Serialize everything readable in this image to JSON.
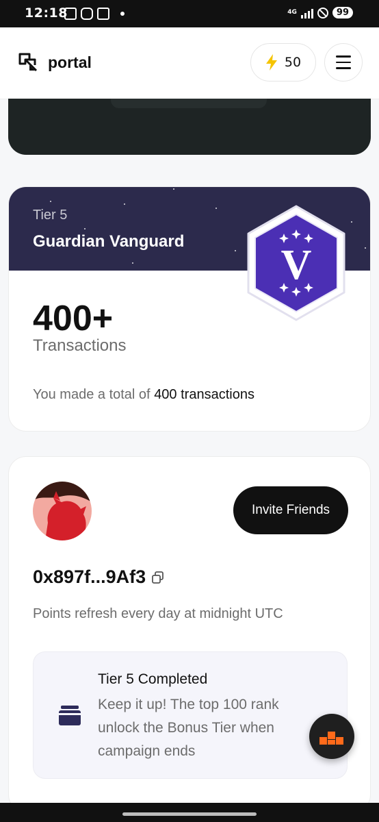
{
  "status_bar": {
    "time": "12:18",
    "network": "4G",
    "battery": "99"
  },
  "header": {
    "app_name": "portal",
    "points": "50"
  },
  "tier_card": {
    "tier_label": "Tier 5",
    "tier_name": "Guardian Vanguard",
    "badge_letter": "V",
    "count": "400+",
    "count_label": "Transactions",
    "summary_prefix": "You made a total of",
    "summary_value": "400 transactions"
  },
  "profile_card": {
    "invite_label": "Invite Friends",
    "address": "0x897f...9Af3",
    "refresh_note": "Points refresh every day at midnight UTC",
    "status_title": "Tier 5 Completed",
    "status_text": "Keep it up! The top 100 rank unlock the Bonus Tier when campaign ends"
  },
  "colors": {
    "banner": "#2c2a4c",
    "badge_purple": "#4b2fb4",
    "accent_yellow": "#f5c400",
    "fab_orange": "#ff6a1a"
  },
  "icons": [
    "lightning-icon",
    "menu-icon",
    "copy-icon",
    "wallet-icon",
    "portal-logo",
    "brand-logo"
  ]
}
